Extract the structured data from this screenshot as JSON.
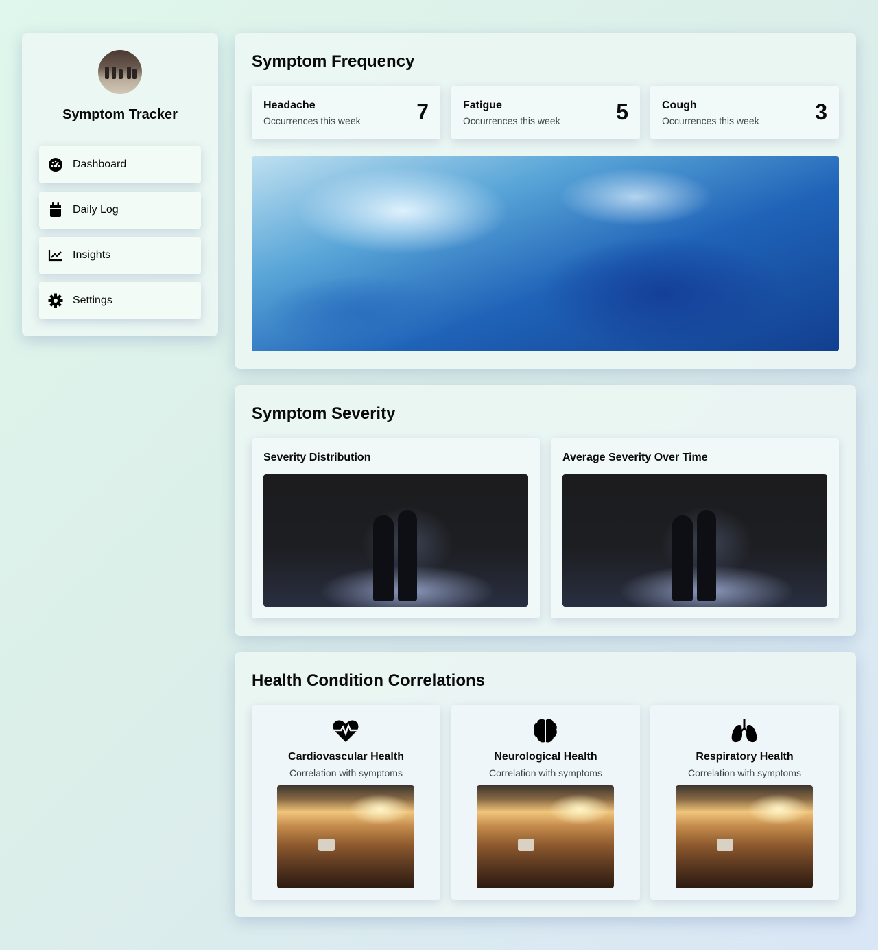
{
  "sidebar": {
    "app_title": "Symptom Tracker",
    "items": [
      {
        "label": "Dashboard",
        "icon": "gauge-icon"
      },
      {
        "label": "Daily Log",
        "icon": "calendar-icon"
      },
      {
        "label": "Insights",
        "icon": "chart-line-icon"
      },
      {
        "label": "Settings",
        "icon": "gear-icon"
      }
    ]
  },
  "frequency": {
    "title": "Symptom Frequency",
    "stats": [
      {
        "name": "Headache",
        "sub": "Occurrences this week",
        "count": "7"
      },
      {
        "name": "Fatigue",
        "sub": "Occurrences this week",
        "count": "5"
      },
      {
        "name": "Cough",
        "sub": "Occurrences this week",
        "count": "3"
      }
    ]
  },
  "severity": {
    "title": "Symptom Severity",
    "cards": [
      {
        "title": "Severity Distribution"
      },
      {
        "title": "Average Severity Over Time"
      }
    ]
  },
  "correlations": {
    "title": "Health Condition Correlations",
    "cards": [
      {
        "title": "Cardiovascular Health",
        "sub": "Correlation with symptoms",
        "icon": "heart-pulse-icon"
      },
      {
        "title": "Neurological Health",
        "sub": "Correlation with symptoms",
        "icon": "brain-icon"
      },
      {
        "title": "Respiratory Health",
        "sub": "Correlation with symptoms",
        "icon": "lungs-icon"
      }
    ]
  },
  "colors": {
    "background_start": "#dff7ec",
    "background_end": "#d9e6f6",
    "panel": "#ecf7f3",
    "text": "#0a0a0a"
  }
}
